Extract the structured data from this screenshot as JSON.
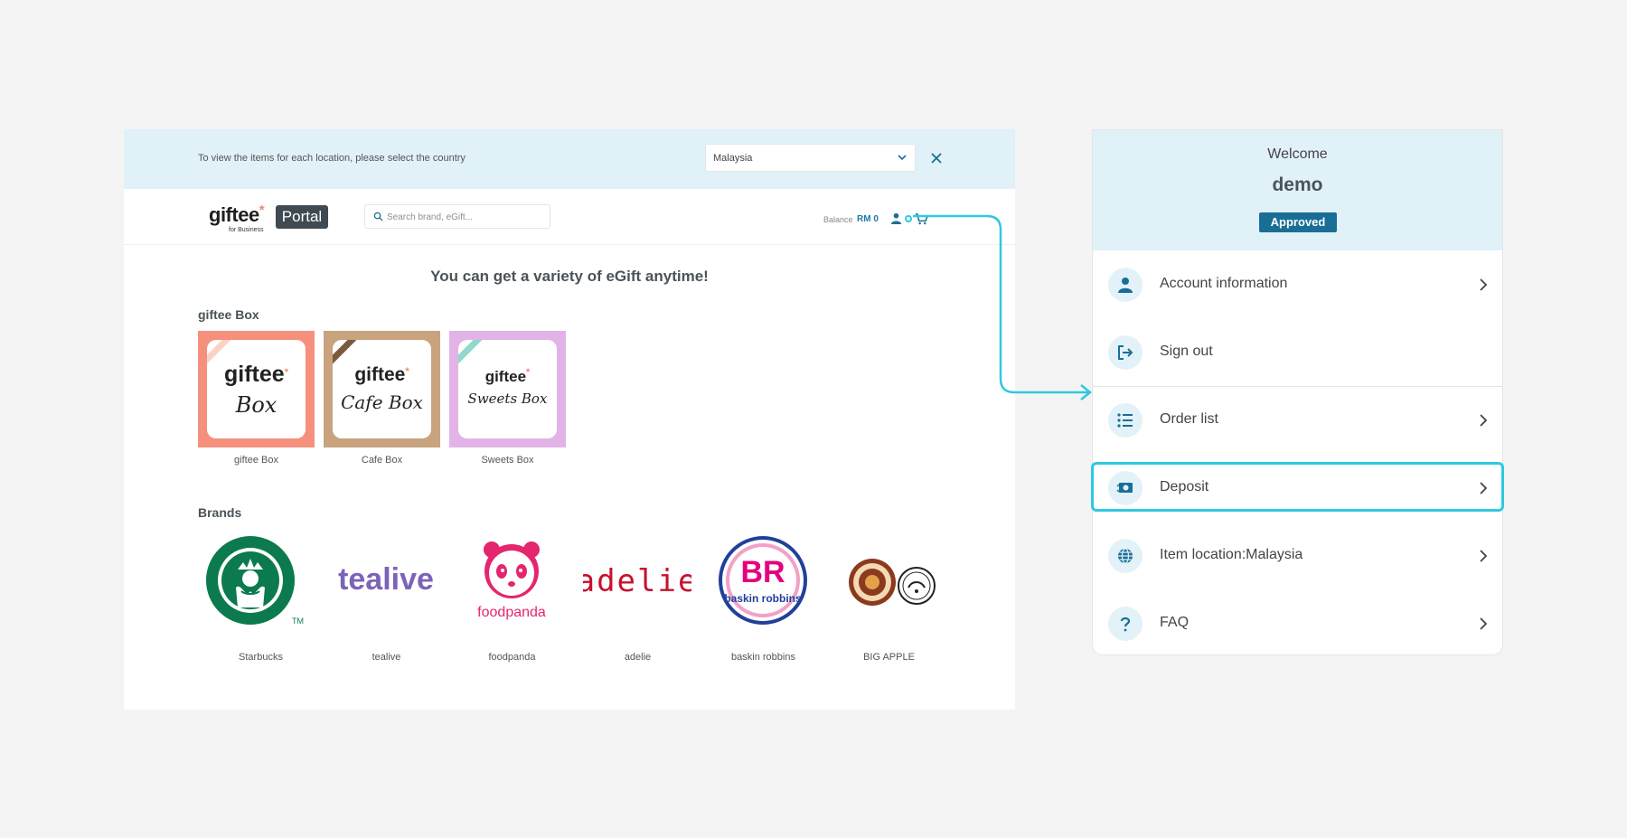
{
  "country_bar": {
    "message": "To view the items for each location, please select the country",
    "selected_country": "Malaysia"
  },
  "header": {
    "logo_word": "giftee",
    "logo_star": "*",
    "logo_sub": "for Business",
    "logo_badge": "Portal",
    "search_placeholder": "Search brand, eGift...",
    "balance_label": "Balance",
    "balance_value": "RM 0"
  },
  "main": {
    "headline": "You can get a variety of eGift anytime!",
    "giftee_box_title": "giftee Box",
    "boxes": [
      {
        "caption": "giftee Box",
        "logo_word": "giftee",
        "script": "Box",
        "bg": "#f4907c",
        "ribbon": "#fbd3c6"
      },
      {
        "caption": "Cafe Box",
        "logo_word": "giftee",
        "script": "Cafe Box",
        "bg": "#c8a37d",
        "ribbon": "#7a5a3d"
      },
      {
        "caption": "Sweets Box",
        "logo_word": "giftee",
        "script": "Sweets Box",
        "bg": "#e2b3e6",
        "ribbon": "#8fd9cf"
      }
    ],
    "brands_title": "Brands",
    "brands": [
      {
        "caption": "Starbucks"
      },
      {
        "caption": "tealive",
        "logo_text": "tealive"
      },
      {
        "caption": "foodpanda",
        "logo_text": "foodpanda"
      },
      {
        "caption": "adelie",
        "logo_text": "adelie"
      },
      {
        "caption": "baskin robbins",
        "logo_text": "BR",
        "logo_sub": "baskin robbins"
      },
      {
        "caption": "BIG APPLE"
      }
    ]
  },
  "account_menu": {
    "welcome": "Welcome",
    "username": "demo",
    "status": "Approved",
    "items": [
      {
        "label": "Account information",
        "icon": "person-icon"
      },
      {
        "label": "Sign out",
        "icon": "sign-out-icon"
      },
      {
        "label": "Order list",
        "icon": "list-icon"
      },
      {
        "label": "Deposit",
        "icon": "deposit-icon"
      },
      {
        "label": "Item location:Malaysia",
        "icon": "globe-icon"
      },
      {
        "label": "FAQ",
        "icon": "question-icon"
      }
    ]
  },
  "colors": {
    "accent": "#1a7aa8",
    "highlight": "#2ec9e0",
    "banner_bg": "#e0f1f8"
  }
}
